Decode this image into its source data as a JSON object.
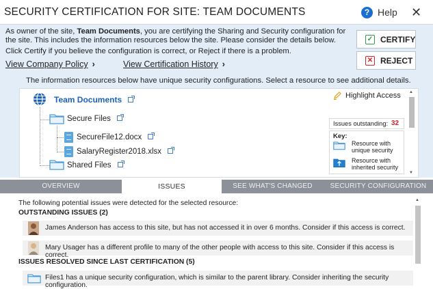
{
  "dialog": {
    "title": "SECURITY CERTIFICATION FOR SITE: TEAM DOCUMENTS",
    "help_label": "Help",
    "close_glyph": "✕"
  },
  "intro": {
    "prefix": "As owner of the site, ",
    "site": "Team Documents",
    "suffix": ",  you are certifying the Sharing and Security configuration for the site. This includes the information resources below the site. Please consider the details below.",
    "instruction": "Click Certify if you believe the configuration is correct, or Reject if there is a problem."
  },
  "links": {
    "company_policy": "View Company Policy",
    "certification_history": "View Certification History",
    "arrow": "›"
  },
  "buttons": {
    "certify": "CERTIFY",
    "reject": "REJECT"
  },
  "resources": {
    "description": "The information resources below have unique security configurations. Select a resource to see additional details.",
    "tree": {
      "site": "Team Documents",
      "secure_folder": "Secure Files",
      "file1": "SecureFile12.docx",
      "file2": "SalaryRegister2018.xlsx",
      "shared_folder": "Shared Files"
    },
    "highlight_access": "Highlight Access",
    "issues_outstanding_label": "Issues outstanding:",
    "issues_outstanding_count": "32",
    "key": {
      "title": "Key:",
      "unique": "Resource with unique security",
      "inherited": "Resource with inherited security"
    }
  },
  "tabs": {
    "overview": "OVERVIEW",
    "issues": "ISSUES",
    "changed": "SEE WHAT'S CHANGED",
    "config": "SECURITY CONFIGURATION"
  },
  "issues": {
    "intro": "The following potential issues were detected for the selected resource:",
    "outstanding_header": "OUTSTANDING ISSUES (2)",
    "items": [
      "James Anderson has access to this site, but has not accessed it in over 6 months. Consider if this access is correct.",
      "Mary Usager has a different profile to many of the other people with access to this site. Consider if this access is correct."
    ],
    "resolved_header": "ISSUES RESOLVED SINCE LAST CERTIFICATION (5)",
    "resolved_items": [
      "Files1 has a unique security configuration, which is similar to the parent library. Consider inheriting the security configuration."
    ]
  },
  "colors": {
    "accent": "#1e62b8",
    "panel": "#e3edf8",
    "tabbar": "#8c9199",
    "issue_count": "#d9202a",
    "certify_green": "#2c9b47",
    "reject_red": "#d0242c"
  }
}
